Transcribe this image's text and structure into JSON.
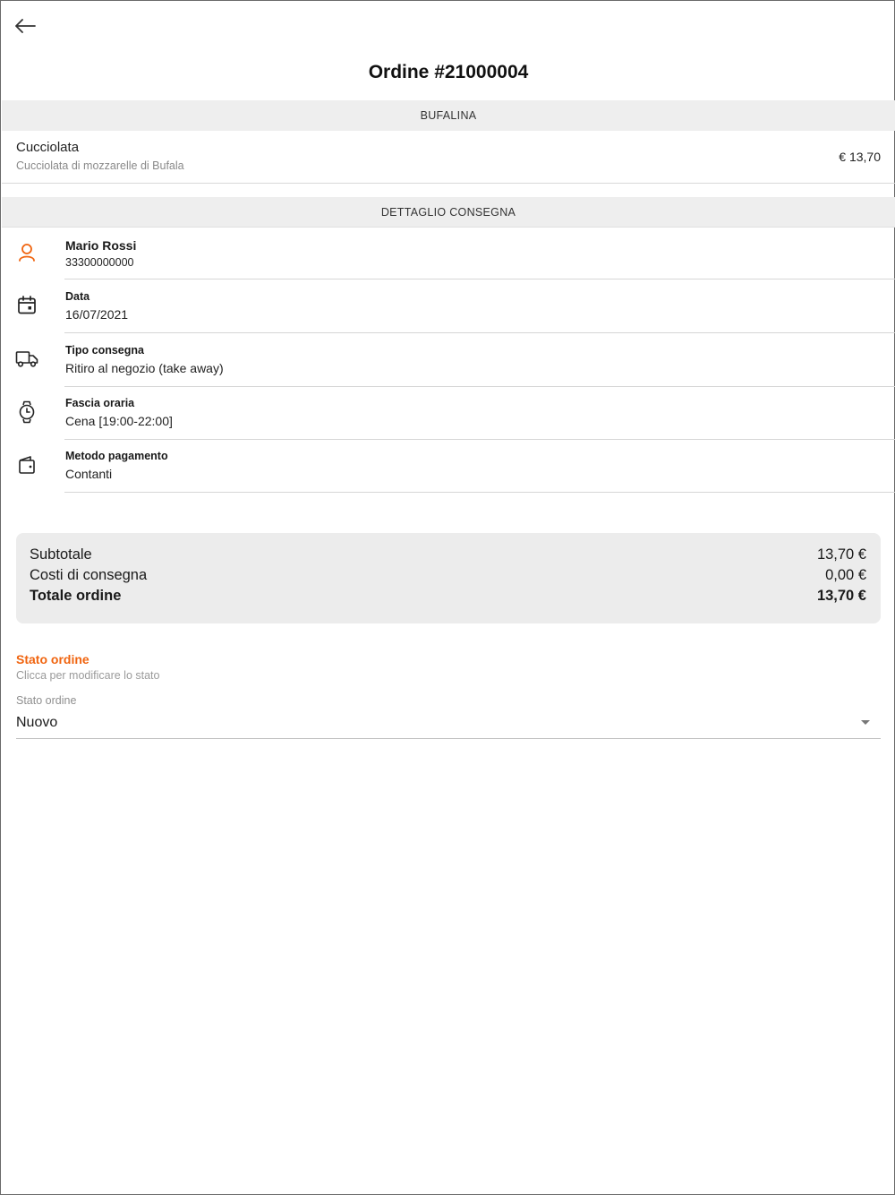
{
  "header": {
    "back_icon": "arrow-left-icon",
    "title": "Ordine #21000004"
  },
  "products_section": {
    "header": "BUFALINA",
    "items": [
      {
        "name": "Cucciolata",
        "description": "Cucciolata di mozzarelle di Bufala",
        "price": "€ 13,70"
      }
    ]
  },
  "delivery_section": {
    "header": "DETTAGLIO CONSEGNA",
    "customer": {
      "icon": "user-icon",
      "name": "Mario Rossi",
      "phone": "33300000000",
      "icon_color": "#f0640f"
    },
    "rows": [
      {
        "icon": "calendar-icon",
        "label": "Data",
        "value": "16/07/2021"
      },
      {
        "icon": "truck-icon",
        "label": "Tipo consegna",
        "value": "Ritiro al negozio (take away)"
      },
      {
        "icon": "watch-icon",
        "label": "Fascia oraria",
        "value": "Cena [19:00-22:00]"
      },
      {
        "icon": "wallet-icon",
        "label": "Metodo pagamento",
        "value": "Contanti"
      }
    ]
  },
  "totals": {
    "subtotal_label": "Subtotale",
    "subtotal_value": "13,70 €",
    "delivery_label": "Costi di consegna",
    "delivery_value": "0,00 €",
    "total_label": "Totale ordine",
    "total_value": "13,70 €"
  },
  "order_status": {
    "title": "Stato ordine",
    "subtitle": "Clicca per modificare lo stato",
    "select_label": "Stato ordine",
    "selected": "Nuovo",
    "accent": "#f0640f"
  }
}
